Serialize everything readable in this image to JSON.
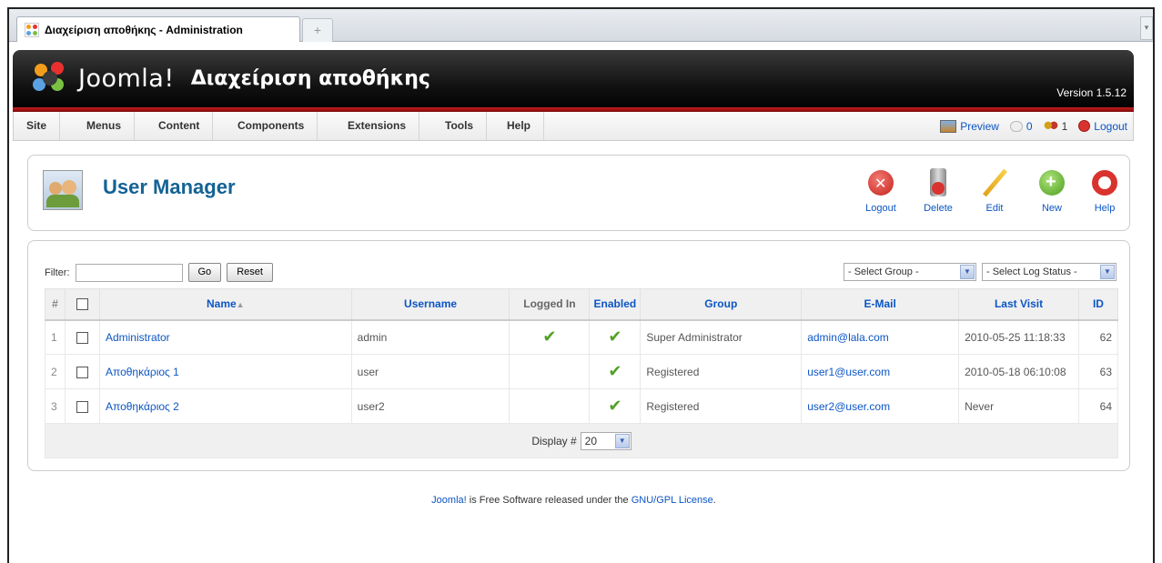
{
  "browser": {
    "tab_title": "Διαχείριση αποθήκης - Administration",
    "new_tab_glyph": "+"
  },
  "header": {
    "logo_text": "Joomla!",
    "site_title": "Διαχείριση αποθήκης",
    "version": "Version 1.5.12"
  },
  "menu": {
    "items": [
      "Site",
      "Menus",
      "Content",
      "Components",
      "Extensions",
      "Tools",
      "Help"
    ]
  },
  "status": {
    "preview": "Preview",
    "messages": "0",
    "users_online": "1",
    "logout": "Logout"
  },
  "toolbar": {
    "title": "User Manager",
    "buttons": [
      "Logout",
      "Delete",
      "Edit",
      "New",
      "Help"
    ]
  },
  "filter": {
    "label": "Filter:",
    "value": "",
    "go": "Go",
    "reset": "Reset",
    "group_select": "- Select Group -",
    "log_status_select": "- Select Log Status -"
  },
  "table": {
    "columns": [
      "#",
      "",
      "Name",
      "Username",
      "Logged In",
      "Enabled",
      "Group",
      "E-Mail",
      "Last Visit",
      "ID"
    ],
    "sort_indicator": "▲",
    "rows": [
      {
        "num": "1",
        "name": "Administrator",
        "username": "admin",
        "logged_in": true,
        "enabled": true,
        "group": "Super Administrator",
        "email": "admin@lala.com",
        "last_visit": "2010-05-25 11:18:33",
        "id": "62"
      },
      {
        "num": "2",
        "name": "Αποθηκάριος 1",
        "username": "user",
        "logged_in": false,
        "enabled": true,
        "group": "Registered",
        "email": "user1@user.com",
        "last_visit": "2010-05-18 06:10:08",
        "id": "63"
      },
      {
        "num": "3",
        "name": "Αποθηκάριος 2",
        "username": "user2",
        "logged_in": false,
        "enabled": true,
        "group": "Registered",
        "email": "user2@user.com",
        "last_visit": "Never",
        "id": "64"
      }
    ],
    "display_label": "Display #",
    "display_value": "20"
  },
  "footer": {
    "link1": "Joomla!",
    "text": " is Free Software released under the ",
    "link2": "GNU/GPL License",
    "end": "."
  },
  "colors": {
    "link": "#0b55c4",
    "title": "#146295",
    "header_red": "#c81c1c",
    "check": "#52a124"
  }
}
